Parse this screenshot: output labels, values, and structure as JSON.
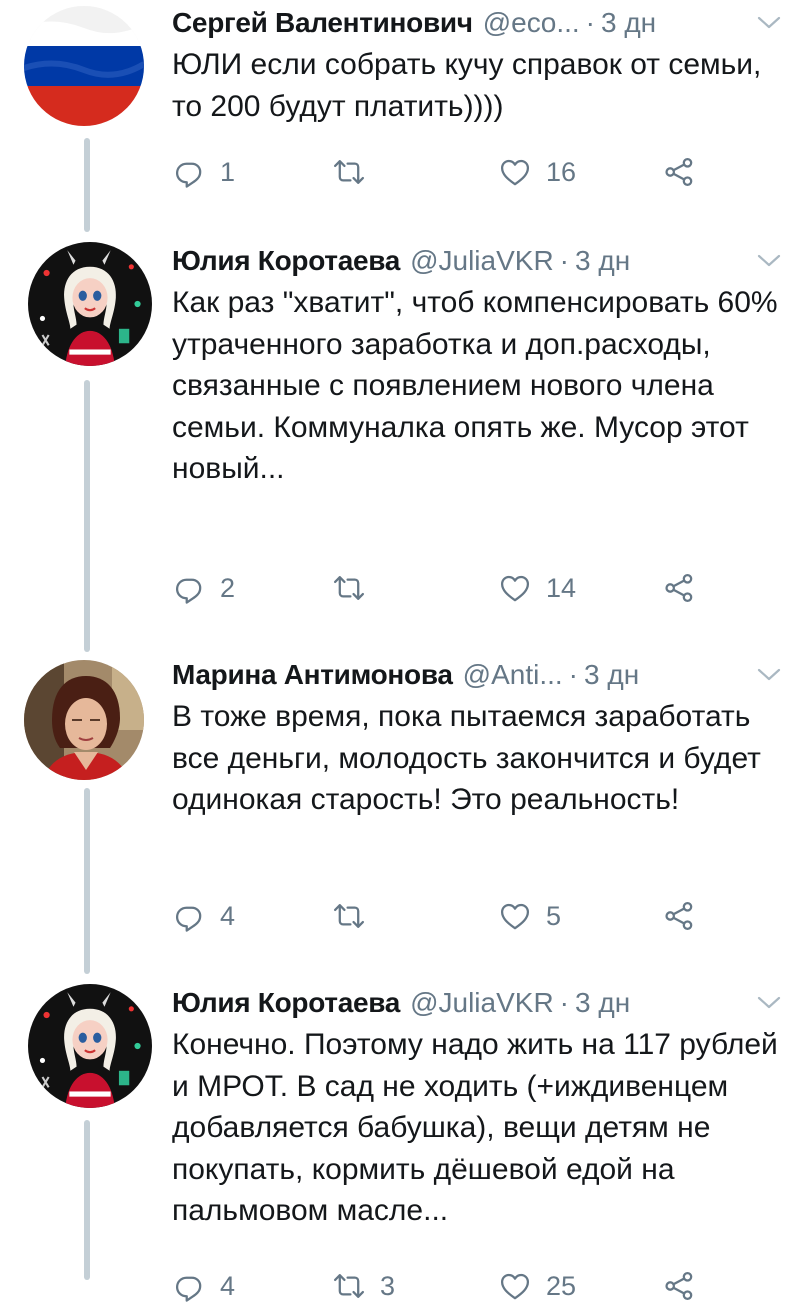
{
  "colors": {
    "text": "#14171a",
    "secondary": "#657786",
    "thread_line": "#c4cfd6"
  },
  "tweets": [
    {
      "name": "Сергей Валентинович",
      "handle": "@eco...",
      "time": "3 дн",
      "text": "ЮЛИ если собрать кучу справок от семьи, то 200 будут платить))))",
      "replies": "1",
      "retweets": "",
      "likes": "16",
      "avatar": "russian-flag"
    },
    {
      "name": "Юлия Коротаева",
      "handle": "@JuliaVKR",
      "time": "3 дн",
      "text": "Как раз \"хватит\", чтоб компенсировать 60% утраченного заработка и доп.расходы, связанные с появлением нового члена семьи. Коммуналка опять же. Мусор этот новый...",
      "replies": "2",
      "retweets": "",
      "likes": "14",
      "avatar": "cartoon-girl"
    },
    {
      "name": "Марина Антимонова",
      "handle": "@Anti...",
      "time": "3 дн",
      "text": "В тоже время, пока пытаемся заработать все деньги, молодость закончится и будет одинокая старость! Это реальность!",
      "replies": "4",
      "retweets": "",
      "likes": "5",
      "avatar": "woman-photo"
    },
    {
      "name": "Юлия Коротаева",
      "handle": "@JuliaVKR",
      "time": "3 дн",
      "text": "Конечно. Поэтому надо жить на 117 рублей и МРОТ. В сад не ходить (+иждивенцем добавляется бабушка), вещи детям не покупать, кормить дёшевой едой на пальмовом масле...",
      "replies": "4",
      "retweets": "3",
      "likes": "25",
      "avatar": "cartoon-girl"
    }
  ]
}
